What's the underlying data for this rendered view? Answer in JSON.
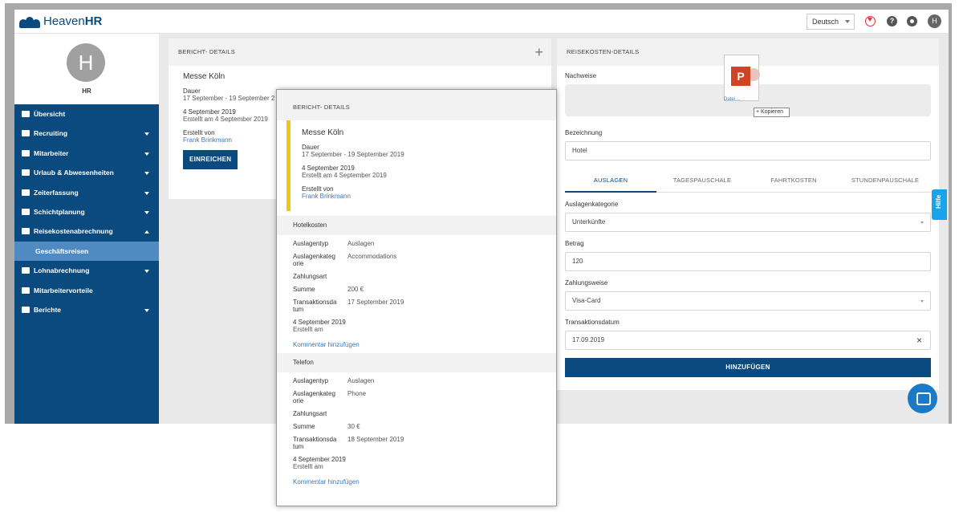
{
  "topbar": {
    "brand_light": "Heaven",
    "brand_bold": "HR",
    "language": "Deutsch",
    "help_icon": "?",
    "user_initial": "H"
  },
  "sidebar": {
    "avatar_initial": "H",
    "name": "HR",
    "items": [
      {
        "label": "Übersicht",
        "icon": "dashboard-icon",
        "chevron": false
      },
      {
        "label": "Recruiting",
        "icon": "recruiting-icon",
        "chevron": true
      },
      {
        "label": "Mitarbeiter",
        "icon": "people-icon",
        "chevron": true
      },
      {
        "label": "Urlaub & Abwesenheiten",
        "icon": "vacation-icon",
        "chevron": true
      },
      {
        "label": "Zeiterfassung",
        "icon": "clock-icon",
        "chevron": true
      },
      {
        "label": "Schichtplanung",
        "icon": "calendar-icon",
        "chevron": true
      },
      {
        "label": "Reisekostenabrechnung",
        "icon": "travel-icon",
        "chevron": true,
        "expanded": true
      },
      {
        "label": "Geschäftsreisen",
        "sub": true
      },
      {
        "label": "Lohnabrechnung",
        "icon": "wallet-icon",
        "chevron": true
      },
      {
        "label": "Mitarbeitervorteile",
        "icon": "shield-icon",
        "chevron": false
      },
      {
        "label": "Berichte",
        "icon": "pie-chart-icon",
        "chevron": true
      }
    ]
  },
  "left_panel": {
    "title": "BERICHT- DETAILS",
    "trip": "Messe Köln",
    "duration_label": "Dauer",
    "duration_value": "17 September - 19 September 2",
    "date": "4 September 2019",
    "created": "Erstellt am 4 September 2019",
    "creator_label": "Erstellt von",
    "creator": "Frank Brinkmann",
    "submit": "EINREICHEN"
  },
  "right_panel": {
    "title": "REISEKOSTEN-DETAILS",
    "proof_label": "Nachweise",
    "file_name": "Datei ...",
    "copy_label": "+ Kopieren",
    "name_label": "Bezeichnung",
    "name_value": "Hotel",
    "tabs": [
      "AUSLAGEN",
      "TAGESPAUSCHALE",
      "FAHRTKOSTEN",
      "STUNDENPAUSCHALE"
    ],
    "category_label": "Auslagenkategorie",
    "category_value": "Unterkünfte",
    "amount_label": "Betrag",
    "amount_value": "120",
    "payment_label": "Zahlungsweise",
    "payment_value": "Visa-Card",
    "date_label": "Transaktionsdatum",
    "date_value": "17.09.2019",
    "clear_icon": "×",
    "add_button": "HINZUFÜGEN",
    "help_tab": "Hilfe"
  },
  "popup": {
    "title": "BERICHT- DETAILS",
    "trip": "Messe Köln",
    "duration_label": "Dauer",
    "duration_value": "17 September - 19 September 2019",
    "date": "4 September 2019",
    "created": "Erstellt am 4 September 2019",
    "creator_label": "Erstellt von",
    "creator": "Frank Brinkmann",
    "sections": [
      {
        "title": "Hotelkosten",
        "rows": [
          {
            "k": "Auslagentyp",
            "v": "Auslagen"
          },
          {
            "k": "Auslagenkateg orie",
            "v": "Accommodations"
          },
          {
            "k": "Zahlungsart",
            "v": ""
          },
          {
            "k": "Summe",
            "v": "200 €"
          },
          {
            "k": "Transaktionsda tum",
            "v": "17 September 2019"
          }
        ],
        "note": "4 September 2019",
        "note2": "Erstellt am",
        "link": "Kommentar hinzufügen"
      },
      {
        "title": "Telefon",
        "rows": [
          {
            "k": "Auslagentyp",
            "v": "Auslagen"
          },
          {
            "k": "Auslagenkateg orie",
            "v": "Phone"
          },
          {
            "k": "Zahlungsart",
            "v": ""
          },
          {
            "k": "Summe",
            "v": "30 €"
          },
          {
            "k": "Transaktionsda tum",
            "v": "18 September 2019"
          }
        ],
        "note": "4 September 2019",
        "note2": "Erstellt am",
        "link": "Kommentar hinzufügen"
      }
    ]
  },
  "colors": {
    "primary": "#0b4a7e",
    "sidebar_active": "#4f8ac2",
    "link": "#3d7ab8",
    "accent_yellow": "#f0c419",
    "help_tab": "#1aa3e8"
  }
}
